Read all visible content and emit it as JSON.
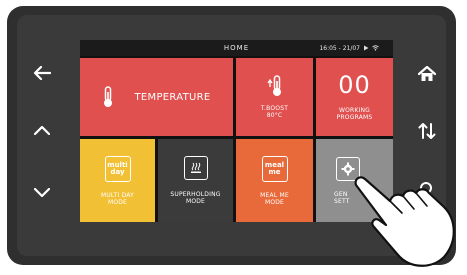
{
  "status_bar": {
    "title": "HOME",
    "time": "16:05 - 21/07"
  },
  "tiles": {
    "temperature": {
      "label": "TEMPERATURE"
    },
    "tboost": {
      "label_line1": "T.BOOST",
      "label_line2": "80°C"
    },
    "working_programs": {
      "count": "00",
      "label_line1": "WORKING",
      "label_line2": "PROGRAMS"
    },
    "multi_day": {
      "icon_line1": "multi",
      "icon_line2": "day",
      "label_line1": "MULTI DAY",
      "label_line2": "MODE"
    },
    "superholding": {
      "label_line1": "SUPERHOLDING",
      "label_line2": "MODE"
    },
    "meal_me": {
      "icon_line1": "meal",
      "icon_line2": "me",
      "label_line1": "MEAL ME",
      "label_line2": "MODE"
    },
    "general_settings": {
      "label_line1": "GEN",
      "label_line2": "SETT"
    }
  },
  "colors": {
    "red": "#e0504f",
    "yellow": "#f2c034",
    "dark_tile": "#3b3b3b",
    "orange": "#e86a3a",
    "grey": "#8f8f8f",
    "bezel": "#2f2f2f"
  },
  "icons": {
    "left": "arrow-left-icon",
    "up": "chevron-up-icon",
    "down": "chevron-down-icon",
    "home": "home-icon",
    "swap": "swap-vertical-icon",
    "search": "search-icon"
  }
}
